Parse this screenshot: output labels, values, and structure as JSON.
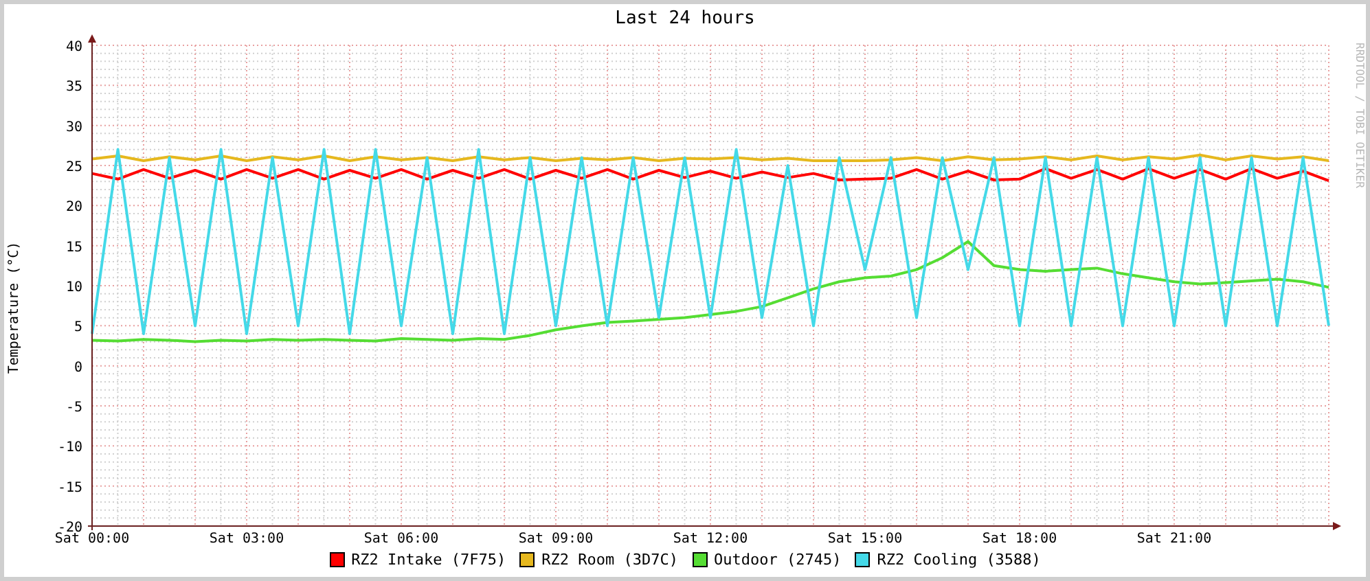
{
  "credit": "RRDTOOL / TOBI OETIKER",
  "chart_data": {
    "type": "line",
    "title": "Last 24 hours",
    "ylabel": "Temperature (°C)",
    "categories": [
      "Sat 00:00",
      null,
      null,
      null,
      null,
      null,
      "Sat 03:00",
      null,
      null,
      null,
      null,
      null,
      "Sat 06:00",
      null,
      null,
      null,
      null,
      null,
      "Sat 09:00",
      null,
      null,
      null,
      null,
      null,
      "Sat 12:00",
      null,
      null,
      null,
      null,
      null,
      "Sat 15:00",
      null,
      null,
      null,
      null,
      null,
      "Sat 18:00",
      null,
      null,
      null,
      null,
      null,
      "Sat 21:00",
      null,
      null,
      null,
      null,
      null,
      null
    ],
    "ylim": [
      -20,
      40
    ],
    "grid": true,
    "yticks": [
      -20,
      -15,
      -10,
      -5,
      0,
      5,
      10,
      15,
      20,
      25,
      30,
      35,
      40
    ],
    "series": [
      {
        "name": "RZ2 Intake (7F75)",
        "color": "#ff0000",
        "values": [
          24,
          23.3,
          24.5,
          23.4,
          24.4,
          23.3,
          24.5,
          23.4,
          24.5,
          23.3,
          24.4,
          23.4,
          24.5,
          23.3,
          24.4,
          23.4,
          24.5,
          23.3,
          24.4,
          23.4,
          24.5,
          23.3,
          24.4,
          23.5,
          24.3,
          23.4,
          24.2,
          23.5,
          24,
          23.2,
          23.3,
          23.4,
          24.5,
          23.3,
          24.3,
          23.2,
          23.3,
          24.6,
          23.4,
          24.5,
          23.3,
          24.6,
          23.4,
          24.5,
          23.3,
          24.6,
          23.4,
          24.3,
          23.1
        ]
      },
      {
        "name": "RZ2 Room (3D7C)",
        "color": "#e6b81e",
        "values": [
          25.8,
          26.2,
          25.6,
          26.1,
          25.7,
          26.2,
          25.6,
          26.1,
          25.7,
          26.2,
          25.6,
          26.1,
          25.7,
          26,
          25.6,
          26.1,
          25.7,
          26,
          25.6,
          25.9,
          25.7,
          26,
          25.6,
          25.9,
          25.8,
          26,
          25.7,
          25.9,
          25.6,
          25.6,
          25.6,
          25.7,
          26,
          25.6,
          26.1,
          25.7,
          25.8,
          26.1,
          25.7,
          26.2,
          25.7,
          26.1,
          25.8,
          26.3,
          25.7,
          26.2,
          25.8,
          26.1,
          25.6
        ]
      },
      {
        "name": "Outdoor (2745)",
        "color": "#55dd33",
        "values": [
          3.2,
          3.1,
          3.3,
          3.2,
          3,
          3.2,
          3.1,
          3.3,
          3.2,
          3.3,
          3.2,
          3.1,
          3.4,
          3.3,
          3.2,
          3.4,
          3.3,
          3.8,
          4.5,
          5,
          5.4,
          5.6,
          5.8,
          6,
          6.4,
          6.8,
          7.4,
          8.5,
          9.6,
          10.5,
          11,
          11.2,
          12,
          13.5,
          15.5,
          12.5,
          12,
          11.8,
          12,
          12.2,
          11.5,
          11,
          10.5,
          10.2,
          10.4,
          10.6,
          10.8,
          10.5,
          9.8
        ]
      },
      {
        "name": "RZ2 Cooling (3588)",
        "color": "#44d9e8",
        "values": [
          4,
          27,
          4,
          26,
          5,
          27,
          4,
          26,
          5,
          27,
          4,
          27,
          5,
          26,
          4,
          27,
          4,
          26,
          5,
          26,
          5,
          26,
          6,
          26,
          6,
          27,
          6,
          25,
          5,
          26,
          12,
          26,
          6,
          26,
          12,
          26,
          5,
          26,
          5,
          26,
          5,
          26,
          5,
          26,
          5,
          26,
          5,
          26,
          5
        ]
      }
    ]
  }
}
